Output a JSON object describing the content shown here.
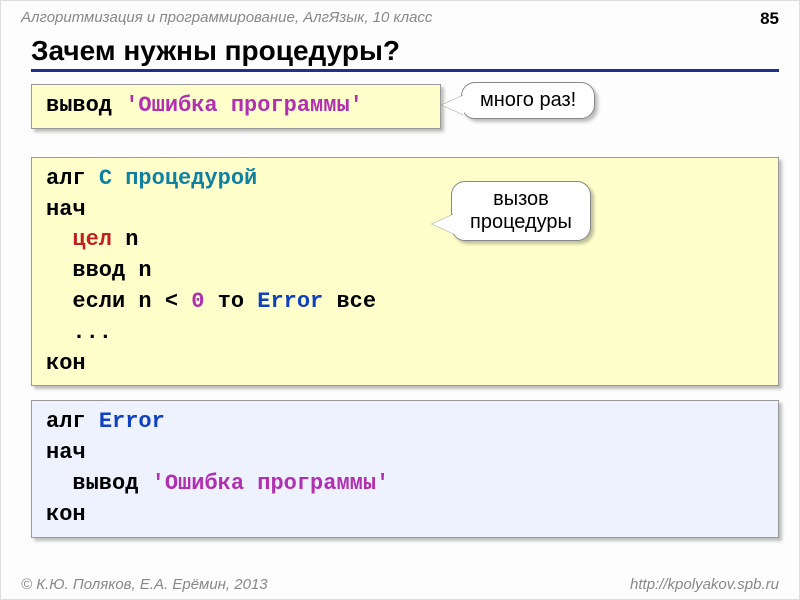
{
  "page": {
    "header": "Алгоритмизация и программирование, АлгЯзык, 10 класс",
    "number": "85",
    "title": "Зачем нужны процедуры?"
  },
  "callouts": {
    "many_times": "много раз!",
    "call_proc_l1": "вызов",
    "call_proc_l2": "процедуры"
  },
  "code1": {
    "t1": "вывод ",
    "t2": "'Ошибка программы'"
  },
  "code2": {
    "l1a": "алг ",
    "l1b": "С процедурой",
    "l2": "нач",
    "l3a": "  ",
    "l3b": "цел",
    "l3c": " n",
    "l4": "  ввод n",
    "l5a": "  если n < ",
    "l5b": "0",
    "l5c": " то ",
    "l5d": "Error",
    "l5e": " все",
    "l6": "  ...",
    "l7": "кон"
  },
  "code3": {
    "l1a": "алг ",
    "l1b": "Error",
    "l2": "нач",
    "l3a": "  вывод ",
    "l3b": "'Ошибка программы'",
    "l4": "кон"
  },
  "footer": {
    "authors": "© К.Ю. Поляков, Е.А. Ерёмин, 2013",
    "url": "http://kpolyakov.spb.ru"
  }
}
